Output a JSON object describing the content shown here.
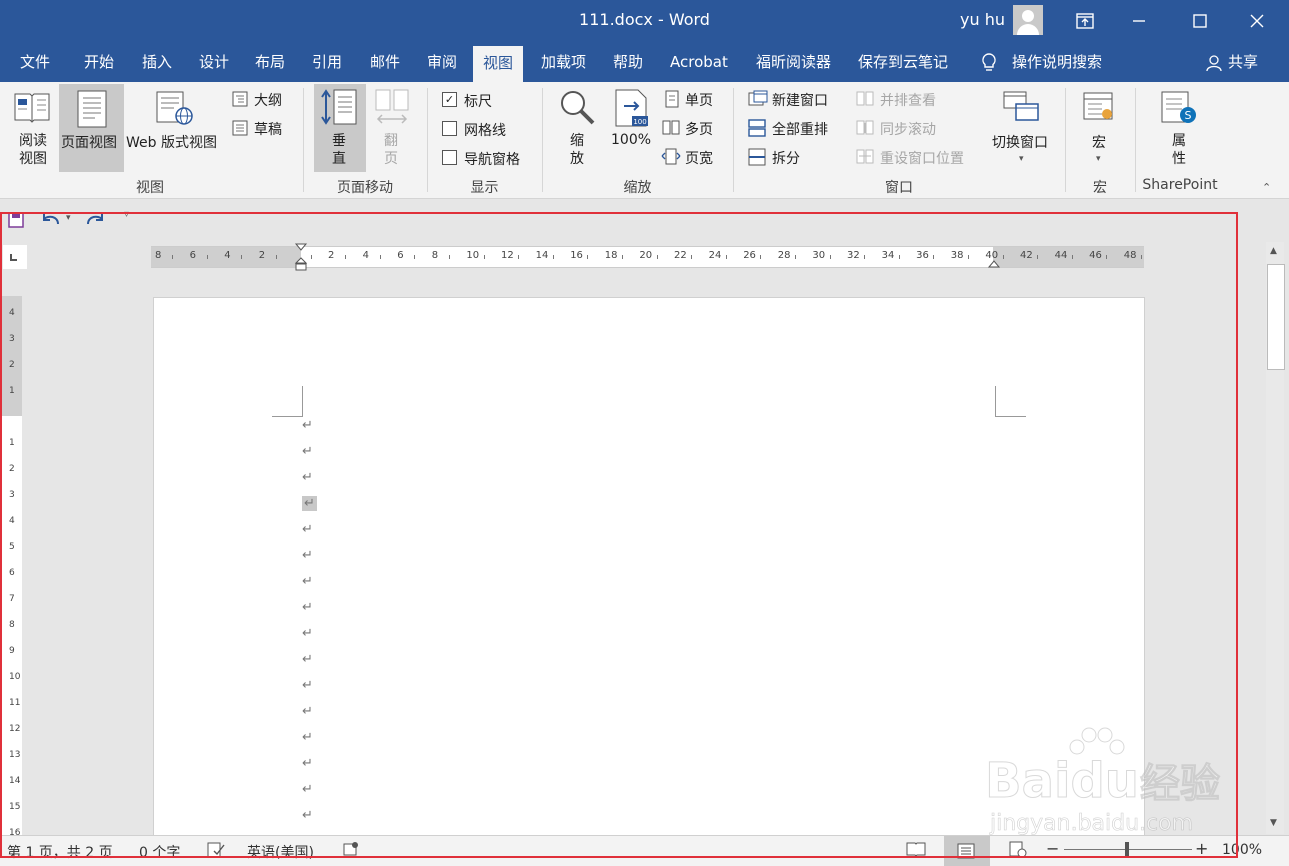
{
  "window": {
    "title": "111.docx  -  Word",
    "user": "yu hu"
  },
  "tabs": [
    "文件",
    "开始",
    "插入",
    "设计",
    "布局",
    "引用",
    "邮件",
    "审阅",
    "视图",
    "加载项",
    "帮助",
    "Acrobat",
    "福昕阅读器",
    "保存到云笔记",
    "操作说明搜索",
    "共享"
  ],
  "ribbon": {
    "views": {
      "read_mode": "阅读\n视图",
      "read_line1": "阅读",
      "read_line2": "视图",
      "print_layout": "页面视图",
      "web_layout": "Web 版式视图",
      "outline": "大纲",
      "draft": "草稿",
      "group_label": "视图"
    },
    "page_movement": {
      "vertical_1": "垂",
      "vertical_2": "直",
      "side_1": "翻",
      "side_2": "页",
      "group_label": "页面移动"
    },
    "show": {
      "ruler": "标尺",
      "ruler_checked": true,
      "gridlines": "网格线",
      "nav_pane": "导航窗格",
      "group_label": "显示"
    },
    "zoom": {
      "zoom_1": "缩",
      "zoom_2": "放",
      "hundred": "100%",
      "one_page": "单页",
      "multi_page": "多页",
      "page_width": "页宽",
      "group_label": "缩放"
    },
    "window": {
      "new_window": "新建窗口",
      "arrange_all": "全部重排",
      "split": "拆分",
      "side_by_side": "并排查看",
      "sync_scroll": "同步滚动",
      "reset_pos": "重设窗口位置",
      "switch_windows": "切换窗口",
      "group_label": "窗口"
    },
    "macros": {
      "label": "宏",
      "group_label": "宏"
    },
    "sharepoint": {
      "prop_1": "属",
      "prop_2": "性",
      "group_label": "SharePoint"
    }
  },
  "ruler": {
    "h_ticks": [
      "8",
      "6",
      "4",
      "2",
      "",
      "2",
      "4",
      "6",
      "8",
      "10",
      "12",
      "14",
      "16",
      "18",
      "20",
      "22",
      "24",
      "26",
      "28",
      "30",
      "32",
      "34",
      "36",
      "38",
      "40",
      "42",
      "44",
      "46",
      "48"
    ],
    "v_ticks": [
      "4",
      "3",
      "2",
      "1",
      "",
      "1",
      "2",
      "3",
      "4",
      "5",
      "6",
      "7",
      "8",
      "9",
      "10",
      "11",
      "12",
      "13",
      "14",
      "15",
      "16"
    ]
  },
  "document": {
    "paragraph_mark": "↵",
    "paragraph_count": 16
  },
  "status": {
    "page": "第 1 页，共 2 页",
    "words": "0 个字",
    "language": "英语(美国)",
    "zoom": "100%"
  },
  "watermark": {
    "brand": "Bai",
    "brand2": "du",
    "cn": "经验",
    "url": "jingyan.baidu.com"
  },
  "colors": {
    "titlebar": "#2b579a",
    "ribbon": "#f3f3f3",
    "highlight_box": "#e0303a"
  }
}
